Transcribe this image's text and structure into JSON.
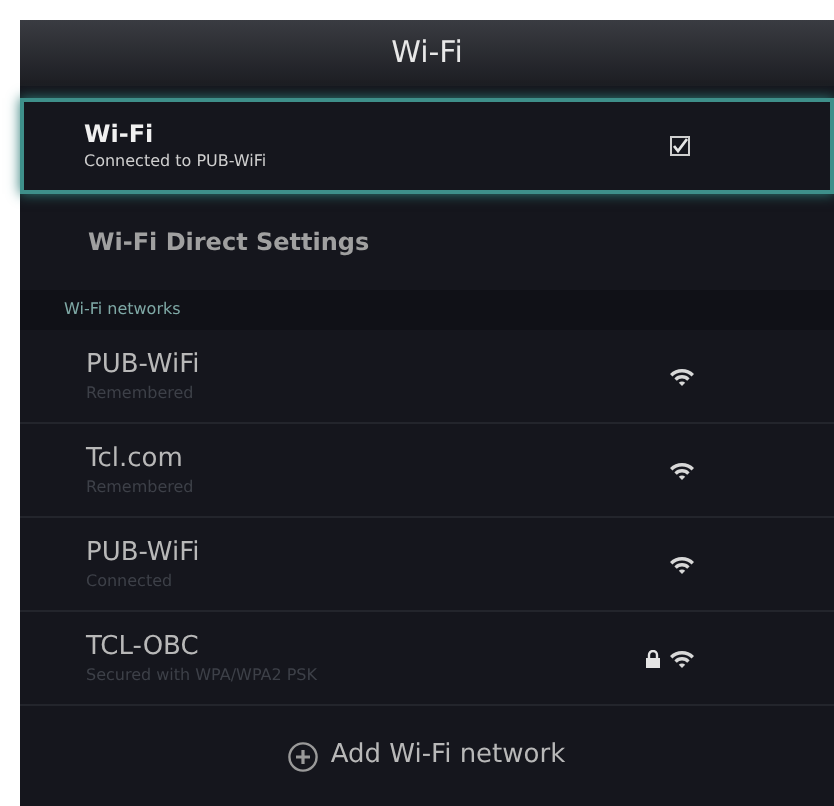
{
  "title": "Wi-Fi",
  "wifi_toggle": {
    "label": "Wi-Fi",
    "status": "Connected to PUB-WiFi",
    "checked": true,
    "selected": true
  },
  "direct_settings": {
    "label": "Wi-Fi Direct Settings"
  },
  "networks_header": "Wi-Fi networks",
  "networks": [
    {
      "name": "PUB-WiFi",
      "status": "Remembered",
      "secured": false
    },
    {
      "name": "Tcl.com",
      "status": "Remembered",
      "secured": false
    },
    {
      "name": "PUB-WiFi",
      "status": "Connected",
      "secured": false
    },
    {
      "name": "TCL-OBC",
      "status": "Secured with WPA/WPA2 PSK",
      "secured": true
    }
  ],
  "add_button": {
    "label": "Add Wi-Fi network"
  }
}
